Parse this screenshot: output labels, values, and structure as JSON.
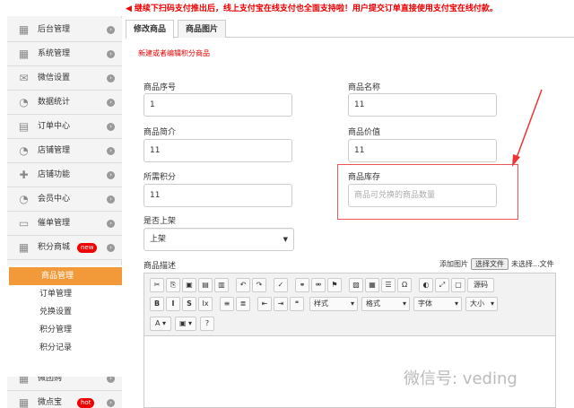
{
  "notice": "继续下扫码支付推出后，线上支付宝在线支付也全面支持啦！用户提交订单直接使用支付宝在线付款。",
  "sidebar": {
    "items": [
      {
        "label": "后台管理",
        "icon": "grid-icon"
      },
      {
        "label": "系统管理",
        "icon": "grid-icon"
      },
      {
        "label": "微信设置",
        "icon": "mail-icon"
      },
      {
        "label": "数据统计",
        "icon": "pie-icon"
      },
      {
        "label": "订单中心",
        "icon": "cart-icon"
      },
      {
        "label": "店铺管理",
        "icon": "pie-icon"
      },
      {
        "label": "店铺功能",
        "icon": "plus-icon"
      },
      {
        "label": "会员中心",
        "icon": "pie-icon"
      },
      {
        "label": "催单管理",
        "icon": "monitor-icon"
      },
      {
        "label": "积分商城",
        "icon": "grid-icon",
        "badge": "new"
      },
      {
        "label": "微团购",
        "icon": "grid-icon"
      },
      {
        "label": "微点宝",
        "icon": "grid-icon",
        "badge": "hot"
      }
    ],
    "submenu": [
      "商品管理",
      "订单管理",
      "兑换设置",
      "积分管理",
      "积分记录"
    ]
  },
  "tabs": [
    "修改商品",
    "商品图片"
  ],
  "breadcrumb": "新建或者编辑积分商品",
  "form": {
    "product_no": {
      "label": "商品序号",
      "value": "1"
    },
    "product_name": {
      "label": "商品名称",
      "value": "11"
    },
    "product_intro": {
      "label": "商品简介",
      "value": "11"
    },
    "product_value": {
      "label": "商品价值",
      "value": "11"
    },
    "points_needed": {
      "label": "所需积分",
      "value": "11"
    },
    "stock": {
      "label": "商品库存",
      "placeholder": "商品可兑换的商品数量"
    },
    "on_shelf": {
      "label": "是否上架",
      "value": "上架"
    },
    "desc": {
      "label": "商品描述"
    }
  },
  "upload": {
    "label": "添加图片",
    "button": "选择文件",
    "status": "未选择...文件"
  },
  "editor": {
    "source": "源码",
    "style": "样式",
    "format": "格式",
    "font": "字体",
    "size": "大小"
  },
  "watermark": "微信号: veding",
  "colors": {
    "accent": "#f29a3a",
    "alert": "#e00000"
  }
}
